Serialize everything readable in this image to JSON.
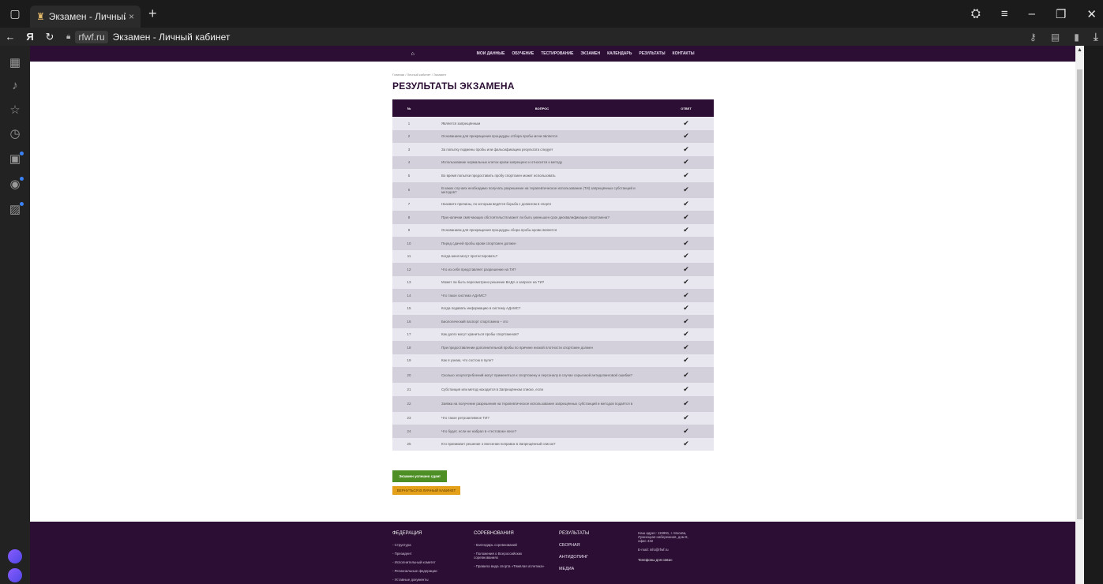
{
  "browser": {
    "tab_title": "Экзамен - Личный каби",
    "close_glyph": "×",
    "new_tab_glyph": "+",
    "url_domain": "rfwf.ru",
    "page_title": "Экзамен - Личный кабинет",
    "ya_glyph": "Я"
  },
  "site": {
    "nav": [
      "МОИ ДАННЫЕ",
      "ОБУЧЕНИЕ",
      "ТЕСТИРОВАНИЕ",
      "ЭКЗАМЕН",
      "КАЛЕНДАРЬ",
      "РЕЗУЛЬТАТЫ",
      "КОНТАКТЫ"
    ],
    "breadcrumb": "Главная / Личный кабинет / Экзамен",
    "heading": "РЕЗУЛЬТАТЫ ЭКЗАМЕНА",
    "table_headers": {
      "num": "№",
      "question": "ВОПРОС",
      "answer": "ОТВЕТ"
    },
    "check_glyph": "✔",
    "rows": [
      {
        "n": "1",
        "q": "Является запрещённым"
      },
      {
        "n": "2",
        "q": "Основанием для прекращения процедуры отбора пробы мочи является"
      },
      {
        "n": "3",
        "q": "За попытку подмены пробы или фальсификацию результата следует"
      },
      {
        "n": "4",
        "q": "Использование нормальных клеток крови запрещено и относится к методу"
      },
      {
        "n": "5",
        "q": "Во время попытки предоставить пробу спортсмен может использовать"
      },
      {
        "n": "6",
        "q": "В каких случаях необходимо получать разрешение на терапевтическое использование (ТИ) запрещённых субстанций и методов?"
      },
      {
        "n": "7",
        "q": "Назовите причины, по которым ведётся борьба с допингом в спорте"
      },
      {
        "n": "8",
        "q": "При наличии смягчающих обстоятельств может ли быть уменьшен срок дисквалификации спортсмена?"
      },
      {
        "n": "9",
        "q": "Основанием для прекращения процедуры сбора пробы крови является"
      },
      {
        "n": "10",
        "q": "Перед сдачей пробы крови спортсмен должен"
      },
      {
        "n": "11",
        "q": "Когда меня могут протестировать?"
      },
      {
        "n": "12",
        "q": "Что из себя представляет разрешение на ТИ?"
      },
      {
        "n": "13",
        "q": "Может ли быть пересмотрено решение ВАДА о запросе на ТИ?"
      },
      {
        "n": "14",
        "q": "Что такое система АДАМС?"
      },
      {
        "n": "15",
        "q": "Когда подавать информацию в систему АДАМС?"
      },
      {
        "n": "16",
        "q": "Биологический паспорт спортсмена – это"
      },
      {
        "n": "17",
        "q": "Как долго могут храниться пробы спортсменов?"
      },
      {
        "n": "18",
        "q": "При предоставлении дополнительной пробы по причине низкой плотности спортсмен должен"
      },
      {
        "n": "19",
        "q": "Как я узнаю, что состою в пуле?"
      },
      {
        "n": "20",
        "q": "Сколько злоупотреблений могут применяться к спортсмену и персоналу в случае серьезной антидопинговой ошибки?"
      },
      {
        "n": "21",
        "q": "Субстанция или метод находится в Запрещённом списке, если"
      },
      {
        "n": "22",
        "q": "Заявка на получение разрешения на терапевтическое использование запрещённых субстанций и методов подаётся в"
      },
      {
        "n": "23",
        "q": "Что такое ретроактивное ТИ?"
      },
      {
        "n": "24",
        "q": "Что будет, если не набрал в «тестовом» весе?"
      },
      {
        "n": "25",
        "q": "Кто принимает решение о внесении поправок в Запрещённый список?"
      }
    ],
    "btn_passed": "Экзамен успешно сдан!",
    "btn_back": "ВЕРНУТЬСЯ В ЛИЧНЫЙ КАБИНЕТ",
    "footer": {
      "federation": {
        "title": "ФЕДЕРАЦИЯ",
        "items": [
          "- Структура",
          "- Президент",
          "- Исполнительный комитет",
          "- Региональные федерации",
          "- Уставные документы"
        ]
      },
      "competitions": {
        "title": "СОРЕВНОВАНИЯ",
        "items": [
          "- Календарь соревнований",
          "- Положения о Всероссийских соревнованиях",
          "- Правила вида спорта «Тяжёлая атлетика»"
        ]
      },
      "results": {
        "title": "РЕЗУЛЬТАТЫ",
        "items": [
          "СБОРНАЯ",
          "АНТИДОПИНГ",
          "МЕДИА"
        ]
      },
      "contacts": {
        "address": "Наш адрес: 119991, г. Москва, Лужнецкая набережная, дом 8, офис 432",
        "email": "E-mail: info@rfwf.ru",
        "phones": "Телефоны для связи:"
      }
    }
  }
}
